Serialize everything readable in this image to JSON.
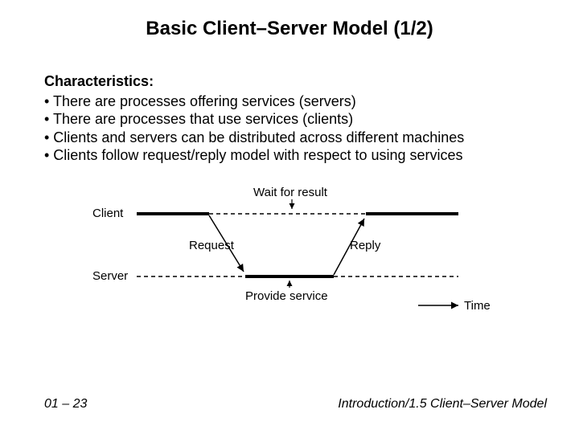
{
  "title": "Basic Client–Server Model (1/2)",
  "characteristics_heading": "Characteristics:",
  "bullets": [
    "• There are processes offering services (servers)",
    "• There are processes that use services (clients)",
    "• Clients and servers can be distributed across different machines",
    "• Clients follow request/reply model with respect to using services"
  ],
  "diagram": {
    "client_label": "Client",
    "server_label": "Server",
    "wait_label": "Wait for result",
    "request_label": "Request",
    "reply_label": "Reply",
    "provide_label": "Provide service",
    "time_label": "Time"
  },
  "footer": {
    "left": "01 – 23",
    "right": "Introduction/1.5 Client–Server Model"
  }
}
